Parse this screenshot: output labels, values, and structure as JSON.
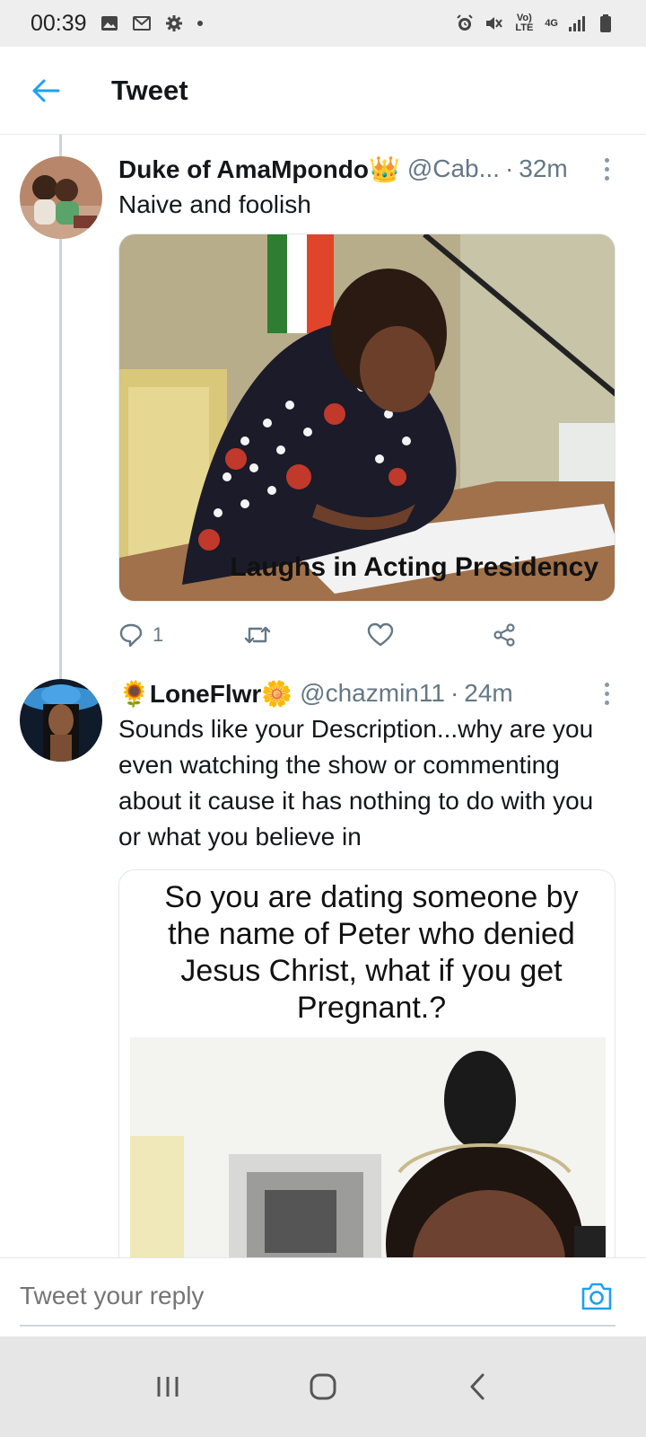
{
  "status_bar": {
    "time": "00:39",
    "icons_left": [
      "image-icon",
      "gmail-icon",
      "settings-icon",
      "notification-dot"
    ],
    "icons_right": [
      "alarm-icon",
      "mute-icon",
      "volte-icon",
      "4g-icon",
      "signal-icon",
      "battery-icon"
    ],
    "volte_label": "Vo) LTE",
    "network_label": "4G"
  },
  "header": {
    "title": "Tweet"
  },
  "tweets": [
    {
      "name": "Duke of AmaMpondo👑",
      "handle": "@Cab...",
      "time": "32m",
      "text": "Naive and foolish",
      "media_caption": "Laughs in Acting Presidency",
      "reply_count": "1"
    },
    {
      "name": "🌻LoneFlwr🌼",
      "handle": "@chazmin11",
      "time": "24m",
      "text": "Sounds like your Description...why are you even watching the show or commenting about it cause it has nothing to do with you or what you believe in",
      "media_text": "So you are dating someone by the name of Peter who denied Jesus Christ, what if you get Pregnant.?"
    }
  ],
  "reply_bar": {
    "placeholder": "Tweet your reply"
  },
  "colors": {
    "accent": "#1da1f2",
    "secondary_text": "#657786",
    "divider": "#e1e8ed"
  }
}
